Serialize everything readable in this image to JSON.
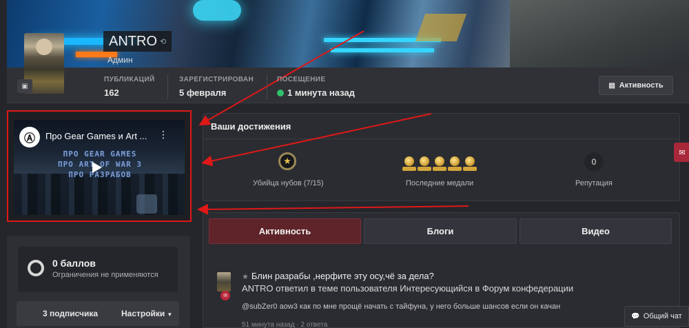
{
  "profile": {
    "name": "ANTRO",
    "role": "Админ",
    "stats": [
      {
        "label": "ПУБЛИКАЦИЙ",
        "value": "162"
      },
      {
        "label": "ЗАРЕГИСТРИРОВАН",
        "value": "5 февраля"
      },
      {
        "label": "ПОСЕЩЕНИЕ",
        "value": "1 минута назад"
      }
    ],
    "activity_button": "Активность"
  },
  "video": {
    "title": "Про Gear Games и Art ...",
    "overlay_lines": [
      "ПРО GEAR GAMES",
      "ПРО ART OF WAR 3",
      "ПРО РАЗРАБОВ"
    ]
  },
  "left_panel": {
    "points_title": "0 баллов",
    "points_sub": "Ограничения не применяются",
    "followers": "3 подписчика",
    "settings": "Настройки"
  },
  "achievements": {
    "title": "Ваши достижения",
    "rank_label": "Убийца нубов (7/15)",
    "medals_label": "Последние медали",
    "reputation_value": "0",
    "reputation_label": "Репутация"
  },
  "tabs": {
    "activity": "Активность",
    "blogs": "Блоги",
    "video": "Видео"
  },
  "feed": {
    "title": "Блин разрабы ,нерфите эту осу,чё за дела?",
    "subtitle": "ANTRO ответил в теме пользователя Интересующийся в Форум конфедерации",
    "body": "@subZer0 aow3 как по мне прощё начать с тайфуна, у него больше шансов если он качан",
    "meta": "51 минута назад   ·   2 ответа"
  },
  "chat_button": "Общий чат",
  "colors": {
    "accent_red": "#5e2429",
    "annotation_red": "#e01818",
    "online_green": "#2ec06b"
  },
  "icons": [
    "image-icon",
    "history-icon",
    "activity-icon",
    "rank-star-icon",
    "medal-icon",
    "mail-icon",
    "chat-icon",
    "comment-icon",
    "star-icon",
    "play-icon",
    "more-vert-icon"
  ]
}
